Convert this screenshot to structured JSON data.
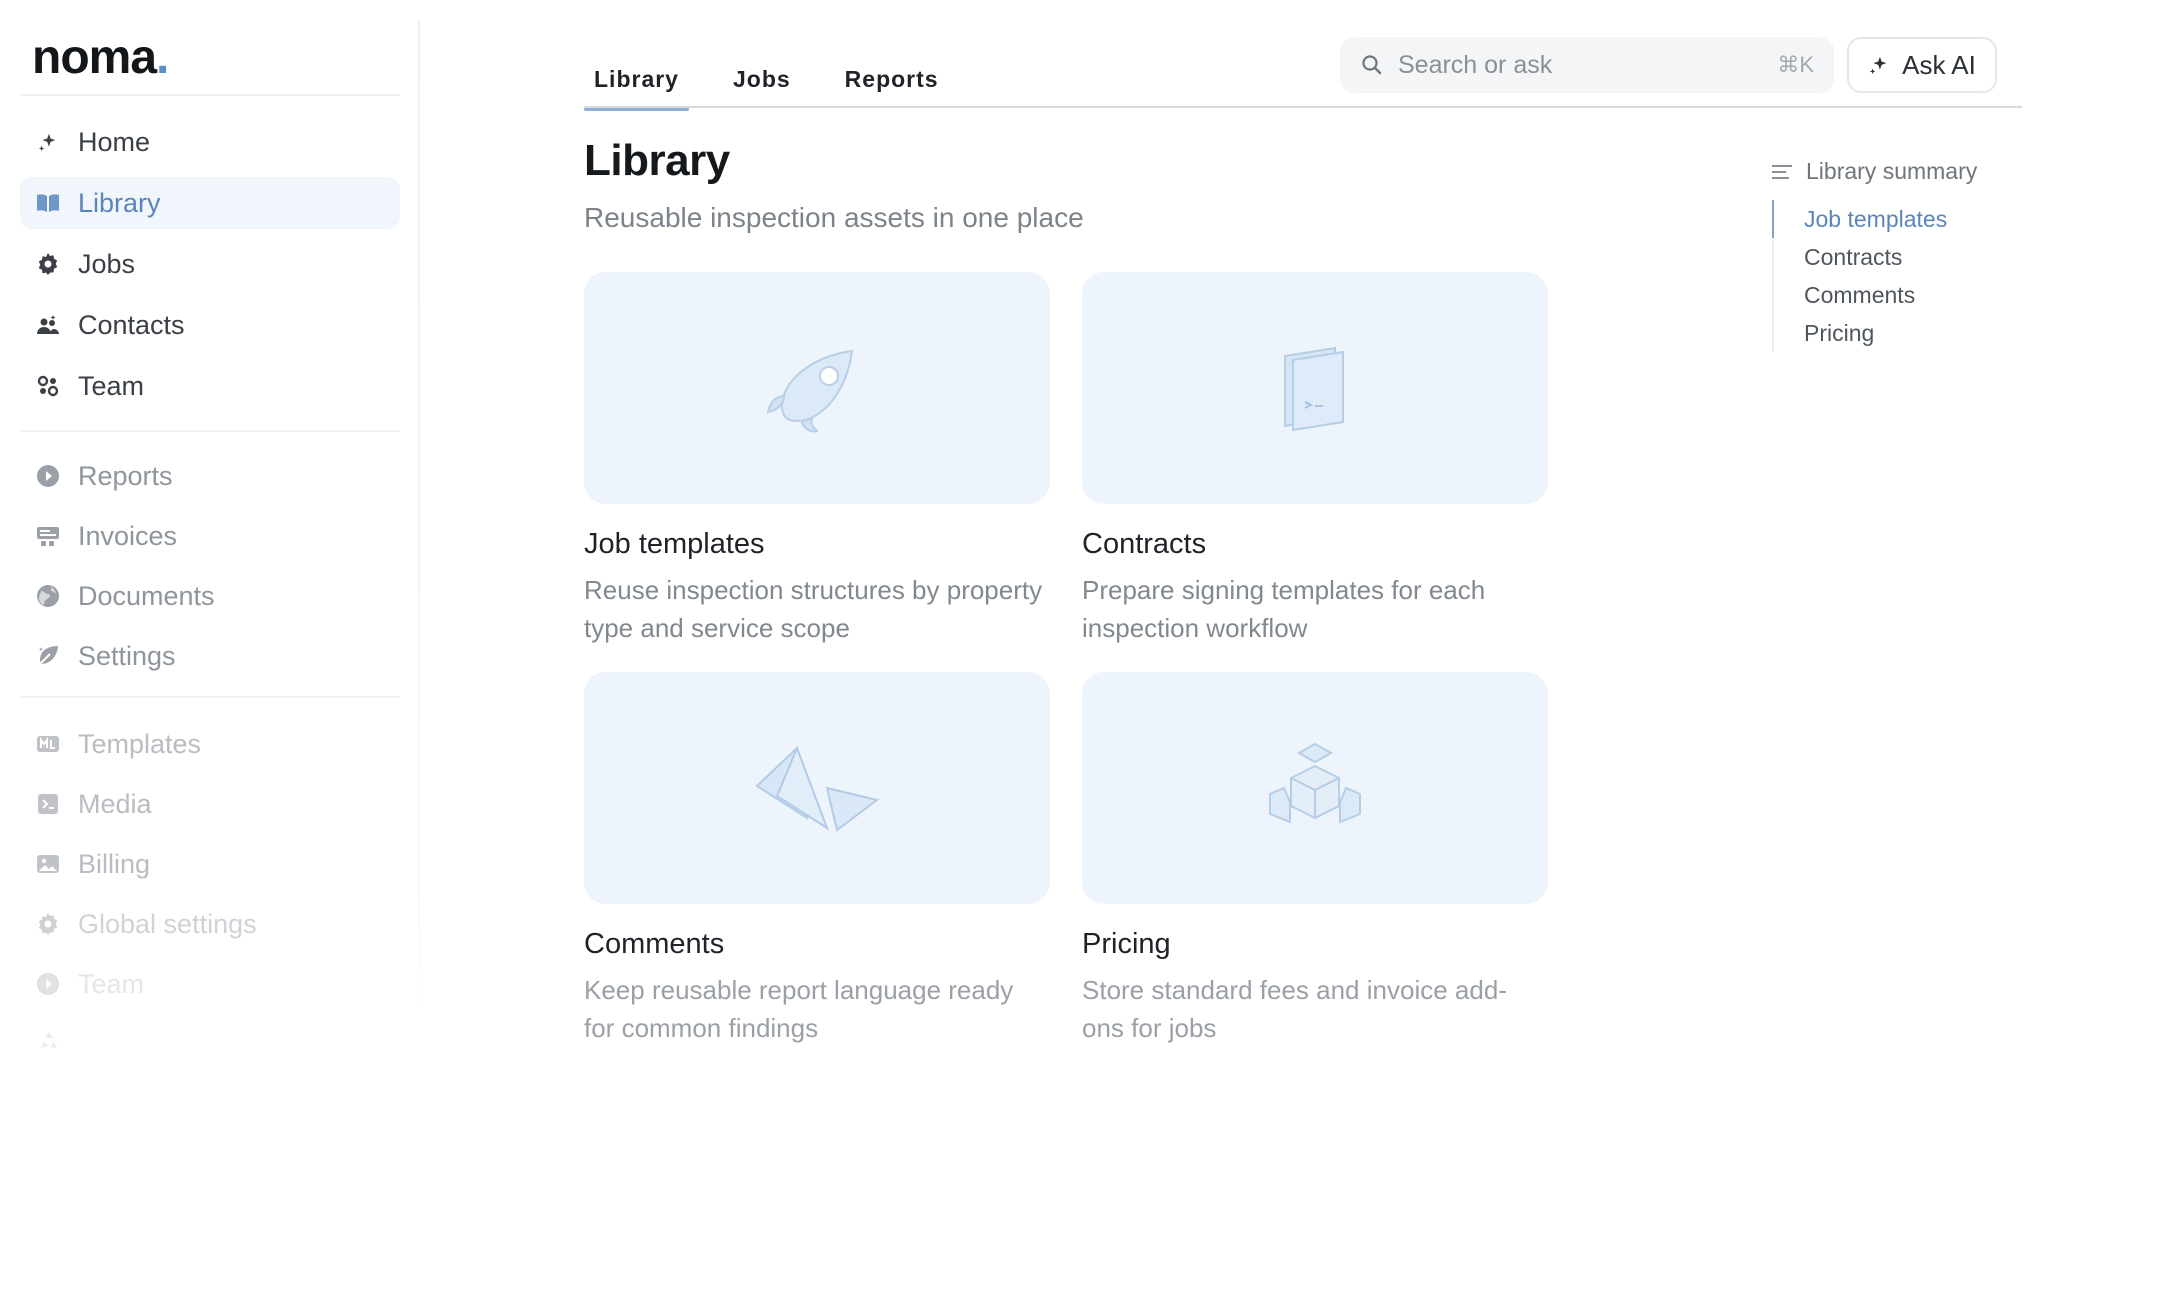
{
  "app": {
    "logo": "noma",
    "logo_dot": "."
  },
  "sidebar": {
    "primary": [
      {
        "label": "Home",
        "icon": "sparkle-icon"
      },
      {
        "label": "Library",
        "icon": "book-icon",
        "active": true
      },
      {
        "label": "Jobs",
        "icon": "gear-icon"
      },
      {
        "label": "Contacts",
        "icon": "contacts-icon"
      },
      {
        "label": "Team",
        "icon": "team-icon"
      }
    ],
    "secondary": [
      {
        "label": "Reports",
        "icon": "play-circle-icon"
      },
      {
        "label": "Invoices",
        "icon": "invoice-icon"
      },
      {
        "label": "Documents",
        "icon": "globe-icon"
      },
      {
        "label": "Settings",
        "icon": "leaf-icon"
      }
    ],
    "tertiary": [
      {
        "label": "Templates",
        "icon": "template-icon"
      },
      {
        "label": "Media",
        "icon": "media-icon"
      },
      {
        "label": "Billing",
        "icon": "image-icon"
      },
      {
        "label": "Global settings",
        "icon": "gear-icon"
      },
      {
        "label": "Team",
        "icon": "play-circle-icon"
      }
    ]
  },
  "tabs": [
    {
      "label": "Library",
      "active": true
    },
    {
      "label": "Jobs"
    },
    {
      "label": "Reports"
    }
  ],
  "search": {
    "placeholder": "Search or ask",
    "shortcut": "⌘K"
  },
  "ask_ai": {
    "label": "Ask AI"
  },
  "page": {
    "title": "Library",
    "subtitle": "Reusable inspection assets in one place"
  },
  "cards": [
    {
      "title": "Job templates",
      "description": "Reuse inspection structures by property type and service scope",
      "icon": "rocket-icon"
    },
    {
      "title": "Contracts",
      "description": "Prepare signing templates for each inspection workflow",
      "icon": "terminal-window-icon"
    },
    {
      "title": "Comments",
      "description": "Keep reusable report language ready for common findings",
      "icon": "paper-plane-icon"
    },
    {
      "title": "Pricing",
      "description": "Store standard fees and invoice add-ons for jobs",
      "icon": "cubes-icon"
    }
  ],
  "toc": {
    "title": "Library summary",
    "items": [
      {
        "label": "Job templates",
        "active": true
      },
      {
        "label": "Contracts"
      },
      {
        "label": "Comments"
      },
      {
        "label": "Pricing"
      }
    ]
  },
  "colors": {
    "accent": "#5b85b8",
    "card_bg": "#eef4fb",
    "active_nav_bg": "#f1f6fc"
  }
}
